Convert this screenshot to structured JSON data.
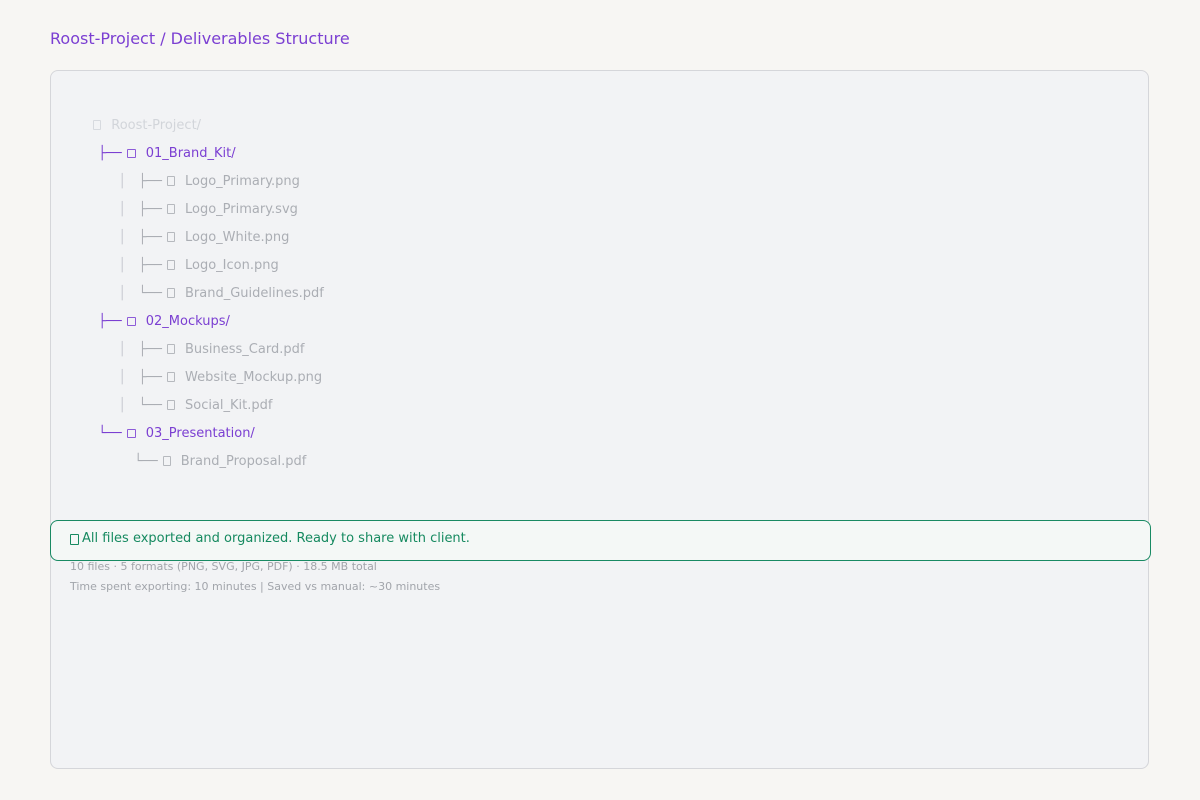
{
  "breadcrumb": "Roost-Project / Deliverables Structure",
  "tree": {
    "root": "Roost-Project/",
    "folders": [
      {
        "name": "01_Brand_Kit/",
        "connector": "├──",
        "files": [
          {
            "name": "Logo_Primary.png",
            "connector": "├──"
          },
          {
            "name": "Logo_Primary.svg",
            "connector": "├──"
          },
          {
            "name": "Logo_White.png",
            "connector": "├──"
          },
          {
            "name": "Logo_Icon.png",
            "connector": "├──"
          },
          {
            "name": "Brand_Guidelines.pdf",
            "connector": "└──"
          }
        ]
      },
      {
        "name": "02_Mockups/",
        "connector": "├──",
        "files": [
          {
            "name": "Business_Card.pdf",
            "connector": "├──"
          },
          {
            "name": "Website_Mockup.png",
            "connector": "├──"
          },
          {
            "name": "Social_Kit.pdf",
            "connector": "└──"
          }
        ]
      },
      {
        "name": "03_Presentation/",
        "connector": "└──",
        "files": [
          {
            "name": "Brand_Proposal.pdf",
            "connector": "└──"
          }
        ]
      }
    ]
  },
  "status": {
    "message": "All files exported and organized. Ready to share with client.",
    "summary": "10 files · 5 formats (PNG, SVG, JPG, PDF) · 18.5 MB total",
    "time": "Time spent exporting: 10 minutes  |  Saved vs manual: ~30 minutes"
  },
  "colors": {
    "accent": "#7b3fd2",
    "success": "#168a60",
    "file_text": "#abaeb4"
  }
}
